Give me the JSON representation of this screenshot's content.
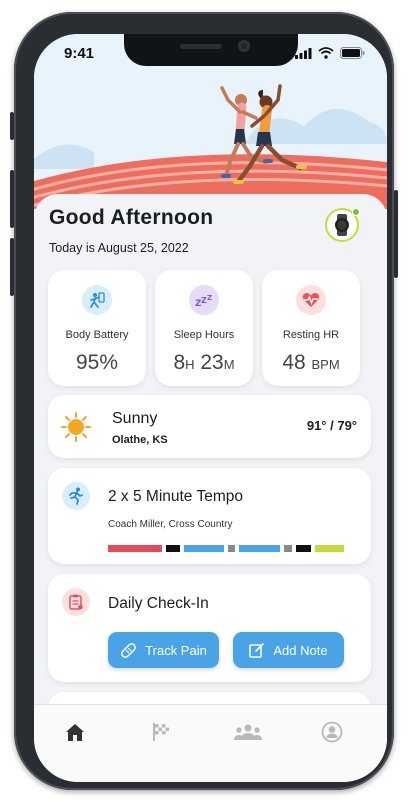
{
  "status_bar": {
    "time": "9:41"
  },
  "header": {
    "greeting": "Good Afternoon",
    "date": "Today is August 25, 2022"
  },
  "metrics": [
    {
      "label": "Body Battery",
      "value": "95%",
      "icon": "battery-icon",
      "color": "#d8eefb"
    },
    {
      "label": "Sleep Hours",
      "value_hours": "8",
      "hours_unit": "H",
      "value_minutes": "23",
      "minutes_unit": "M",
      "icon": "sleep-icon",
      "color": "#e6dcf5"
    },
    {
      "label": "Resting HR",
      "value": "48",
      "unit": "BPM",
      "icon": "heart-rate-icon",
      "color": "#fbe0e0"
    }
  ],
  "weather": {
    "condition": "Sunny",
    "location": "Olathe, KS",
    "temps": "91° / 79°",
    "icon": "sun-icon"
  },
  "workout": {
    "title": "2 x 5 Minute Tempo",
    "subtitle": "Coach Miller, Cross Country",
    "icon": "runner-icon",
    "segment_colors": [
      "#e44b5a",
      "#111111",
      "#4aa3e5",
      "#888888",
      "#4aa3e5",
      "#888888",
      "#111111",
      "#c6d83e"
    ]
  },
  "checkin": {
    "title": "Daily Check-In",
    "icon": "clipboard-icon",
    "track_pain_label": "Track Pain",
    "add_note_label": "Add Note"
  },
  "tabs": [
    {
      "name": "home",
      "icon": "home-icon",
      "active": true
    },
    {
      "name": "races",
      "icon": "flag-icon",
      "active": false
    },
    {
      "name": "team",
      "icon": "team-icon",
      "active": false
    },
    {
      "name": "profile",
      "icon": "profile-icon",
      "active": false
    }
  ],
  "colors": {
    "accent_blue": "#4aa3e5",
    "watch_ring": "#c7db3f",
    "active_tab": "#333333",
    "inactive_tab": "#b9b9bd"
  }
}
